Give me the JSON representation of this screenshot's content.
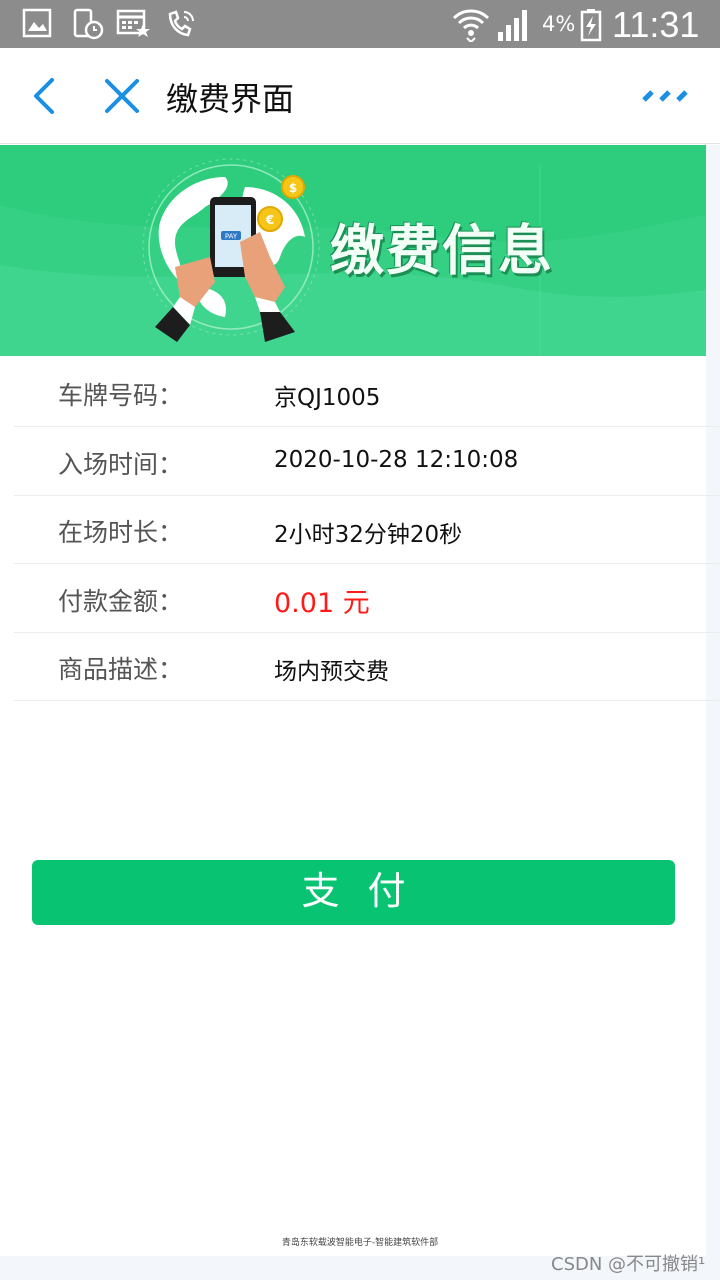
{
  "status_bar": {
    "battery_percent": "4%",
    "time": "11:31",
    "icons": [
      "gallery-icon",
      "phone-clock-icon",
      "calendar-star-icon",
      "call-wifi-icon",
      "wifi-icon",
      "signal-icon",
      "battery-charging-icon"
    ]
  },
  "nav": {
    "title": "缴费界面",
    "icons": [
      "back-chevron-icon",
      "close-icon",
      "more-dots-icon"
    ],
    "accent_color": "#1a8fe3"
  },
  "banner": {
    "title": "缴费信息",
    "pay_label": "PAY",
    "colors": {
      "background": "#2ecc7d",
      "text": "#f2fff7"
    }
  },
  "info": {
    "rows": [
      {
        "label": "车牌号码：",
        "value": "京QJ1005"
      },
      {
        "label": "入场时间：",
        "value": "2020-10-28 12:10:08"
      },
      {
        "label": "在场时长：",
        "value": "2小时32分钟20秒"
      },
      {
        "label": "付款金额：",
        "value": "0.01 元"
      },
      {
        "label": "商品描述：",
        "value": "场内预交费"
      }
    ],
    "amount_color": "#ff1a1a"
  },
  "pay_button": {
    "label": "支付",
    "color": "#08c472"
  },
  "footer": {
    "text": "青岛东软载波智能电子-智能建筑软件部"
  },
  "watermark": {
    "text": "CSDN @不可撤销¹"
  }
}
